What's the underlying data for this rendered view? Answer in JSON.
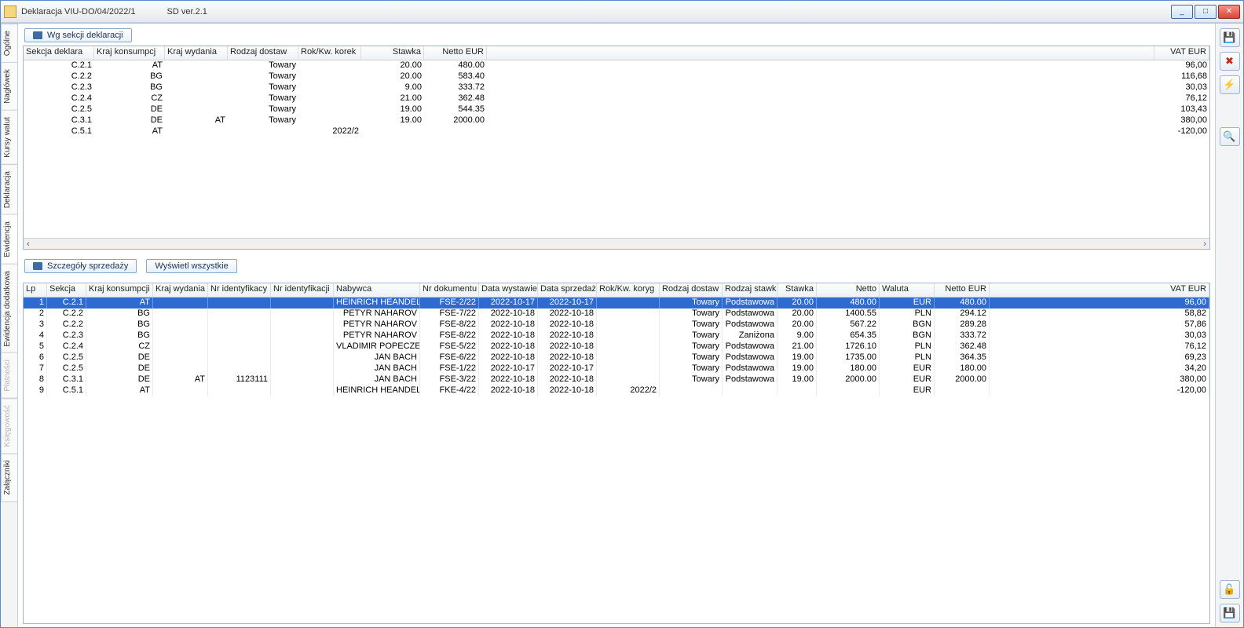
{
  "window": {
    "title": "Deklaracja VIU-DO/04/2022/1",
    "version": "SD ver.2.1",
    "buttons": {
      "min": "_",
      "max": "□",
      "close": "✕"
    }
  },
  "vtabs": [
    {
      "label": "Ogólne",
      "state": "normal"
    },
    {
      "label": "Nagłówek",
      "state": "normal"
    },
    {
      "label": "Kursy walut",
      "state": "normal"
    },
    {
      "label": "Deklaracja",
      "state": "normal"
    },
    {
      "label": "Ewidencja",
      "state": "active"
    },
    {
      "label": "Ewidencja dodatkowa",
      "state": "normal"
    },
    {
      "label": "Płatności",
      "state": "disabled"
    },
    {
      "label": "Księgowość",
      "state": "disabled"
    },
    {
      "label": "Załączniki",
      "state": "normal"
    }
  ],
  "rtoolbar": {
    "save": "💾",
    "delete": "✖",
    "bolt": "⚡",
    "search": "🔍",
    "lock": "🔓",
    "disk": "💾"
  },
  "top": {
    "button": "Wg sekcji deklaracji",
    "columns": [
      "Sekcja deklara",
      "Kraj konsumpcj",
      "Kraj wydania",
      "Rodzaj dostaw",
      "Rok/Kw. korek",
      "Stawka",
      "Netto EUR",
      "",
      "VAT EUR"
    ],
    "rows": [
      {
        "sek": "C.2.1",
        "kk": "AT",
        "kw": "",
        "rd": "Towary",
        "rok": "",
        "st": "20.00",
        "net": "480.00",
        "vat": "96,00"
      },
      {
        "sek": "C.2.2",
        "kk": "BG",
        "kw": "",
        "rd": "Towary",
        "rok": "",
        "st": "20.00",
        "net": "583.40",
        "vat": "116,68"
      },
      {
        "sek": "C.2.3",
        "kk": "BG",
        "kw": "",
        "rd": "Towary",
        "rok": "",
        "st": "9.00",
        "net": "333.72",
        "vat": "30,03"
      },
      {
        "sek": "C.2.4",
        "kk": "CZ",
        "kw": "",
        "rd": "Towary",
        "rok": "",
        "st": "21.00",
        "net": "362.48",
        "vat": "76,12"
      },
      {
        "sek": "C.2.5",
        "kk": "DE",
        "kw": "",
        "rd": "Towary",
        "rok": "",
        "st": "19.00",
        "net": "544.35",
        "vat": "103,43"
      },
      {
        "sek": "C.3.1",
        "kk": "DE",
        "kw": "AT",
        "rd": "Towary",
        "rok": "",
        "st": "19.00",
        "net": "2000.00",
        "vat": "380,00"
      },
      {
        "sek": "C.5.1",
        "kk": "AT",
        "kw": "",
        "rd": "",
        "rok": "2022/2",
        "st": "",
        "net": "",
        "vat": "-120,00"
      }
    ]
  },
  "bottom": {
    "button1": "Szczegóły sprzedaży",
    "button2": "Wyświetl wszystkie",
    "columns": [
      "Lp",
      "Sekcja",
      "Kraj konsumpcji",
      "Kraj wydania",
      "Nr identyfikacy",
      "Nr identyfikacji ",
      "Nabywca",
      "Nr dokumentu",
      "Data wystawie",
      "Data sprzedaż",
      "Rok/Kw. koryg",
      "Rodzaj dostaw",
      "Rodzaj stawki",
      "Stawka",
      "Netto",
      "Waluta",
      "Netto EUR",
      "VAT EUR"
    ],
    "rows": [
      {
        "lp": "1",
        "sek": "C.2.1",
        "kk": "AT",
        "kw": "",
        "ni1": "",
        "ni2": "",
        "nab": "HEINRICH HEANDEL",
        "nd": "FSE-2/22",
        "dw": "2022-10-17",
        "ds": "2022-10-17",
        "rok": "",
        "rd": "Towary",
        "rs": "Podstawowa",
        "st": "20.00",
        "net": "480.00",
        "wal": "EUR",
        "neu": "480.00",
        "vat": "96,00",
        "selected": true
      },
      {
        "lp": "2",
        "sek": "C.2.2",
        "kk": "BG",
        "kw": "",
        "ni1": "",
        "ni2": "",
        "nab": "PETYR NAHAROV",
        "nd": "FSE-7/22",
        "dw": "2022-10-18",
        "ds": "2022-10-18",
        "rok": "",
        "rd": "Towary",
        "rs": "Podstawowa",
        "st": "20.00",
        "net": "1400.55",
        "wal": "PLN",
        "neu": "294.12",
        "vat": "58,82"
      },
      {
        "lp": "3",
        "sek": "C.2.2",
        "kk": "BG",
        "kw": "",
        "ni1": "",
        "ni2": "",
        "nab": "PETYR NAHAROV",
        "nd": "FSE-8/22",
        "dw": "2022-10-18",
        "ds": "2022-10-18",
        "rok": "",
        "rd": "Towary",
        "rs": "Podstawowa",
        "st": "20.00",
        "net": "567.22",
        "wal": "BGN",
        "neu": "289.28",
        "vat": "57,86"
      },
      {
        "lp": "4",
        "sek": "C.2.3",
        "kk": "BG",
        "kw": "",
        "ni1": "",
        "ni2": "",
        "nab": "PETYR NAHAROV",
        "nd": "FSE-8/22",
        "dw": "2022-10-18",
        "ds": "2022-10-18",
        "rok": "",
        "rd": "Towary",
        "rs": "Zaniżona",
        "st": "9.00",
        "net": "654.35",
        "wal": "BGN",
        "neu": "333.72",
        "vat": "30,03"
      },
      {
        "lp": "5",
        "sek": "C.2.4",
        "kk": "CZ",
        "kw": "",
        "ni1": "",
        "ni2": "",
        "nab": "VLADIMIR POPECZEK",
        "nd": "FSE-5/22",
        "dw": "2022-10-18",
        "ds": "2022-10-18",
        "rok": "",
        "rd": "Towary",
        "rs": "Podstawowa",
        "st": "21.00",
        "net": "1726.10",
        "wal": "PLN",
        "neu": "362.48",
        "vat": "76,12"
      },
      {
        "lp": "6",
        "sek": "C.2.5",
        "kk": "DE",
        "kw": "",
        "ni1": "",
        "ni2": "",
        "nab": "JAN BACH",
        "nd": "FSE-6/22",
        "dw": "2022-10-18",
        "ds": "2022-10-18",
        "rok": "",
        "rd": "Towary",
        "rs": "Podstawowa",
        "st": "19.00",
        "net": "1735.00",
        "wal": "PLN",
        "neu": "364.35",
        "vat": "69,23"
      },
      {
        "lp": "7",
        "sek": "C.2.5",
        "kk": "DE",
        "kw": "",
        "ni1": "",
        "ni2": "",
        "nab": "JAN BACH",
        "nd": "FSE-1/22",
        "dw": "2022-10-17",
        "ds": "2022-10-17",
        "rok": "",
        "rd": "Towary",
        "rs": "Podstawowa",
        "st": "19.00",
        "net": "180.00",
        "wal": "EUR",
        "neu": "180.00",
        "vat": "34,20"
      },
      {
        "lp": "8",
        "sek": "C.3.1",
        "kk": "DE",
        "kw": "AT",
        "ni1": "1123111",
        "ni2": "",
        "nab": "JAN BACH",
        "nd": "FSE-3/22",
        "dw": "2022-10-18",
        "ds": "2022-10-18",
        "rok": "",
        "rd": "Towary",
        "rs": "Podstawowa",
        "st": "19.00",
        "net": "2000.00",
        "wal": "EUR",
        "neu": "2000.00",
        "vat": "380,00"
      },
      {
        "lp": "9",
        "sek": "C.5.1",
        "kk": "AT",
        "kw": "",
        "ni1": "",
        "ni2": "",
        "nab": "HEINRICH HEANDEL",
        "nd": "FKE-4/22",
        "dw": "2022-10-18",
        "ds": "2022-10-18",
        "rok": "2022/2",
        "rd": "",
        "rs": "",
        "st": "",
        "net": "",
        "wal": "EUR",
        "neu": "",
        "vat": "-120,00"
      }
    ]
  }
}
